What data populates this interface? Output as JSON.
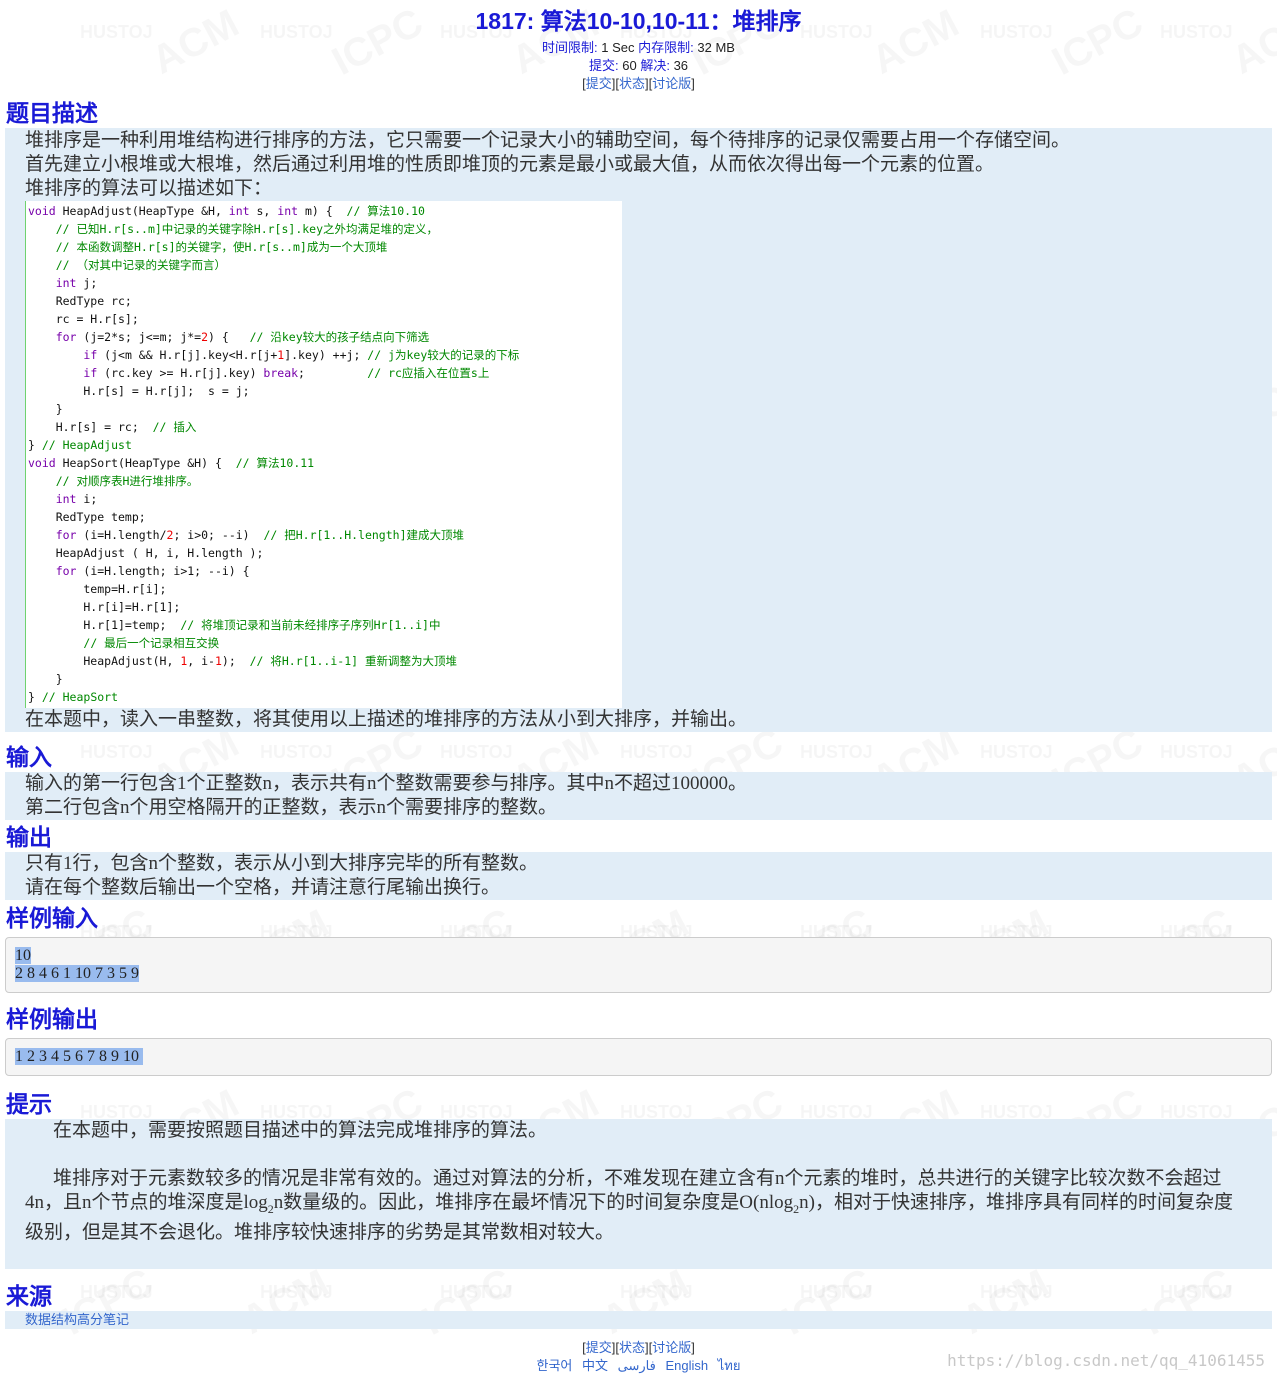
{
  "header": {
    "title": "1817: 算法10-10,10-11：堆排序",
    "time_label": "时间限制:",
    "time_value": "1 Sec",
    "mem_label": "内存限制:",
    "mem_value": "32 MB",
    "submit_label": "提交:",
    "submit_value": "60",
    "solved_label": "解决:",
    "solved_value": "36",
    "links": [
      "提交",
      "状态",
      "讨论版"
    ]
  },
  "description": {
    "heading": "题目描述",
    "intro": [
      "堆排序是一种利用堆结构进行排序的方法，它只需要一个记录大小的辅助空间，每个待排序的记录仅需要占用一个存储空间。",
      "首先建立小根堆或大根堆，然后通过利用堆的性质即堆顶的元素是最小或最大值，从而依次得出每一个元素的位置。",
      "堆排序的算法可以描述如下："
    ],
    "code": [
      "void HeapAdjust(HeapType &H, int s, int m) {  // 算法10.10",
      "    // 已知H.r[s..m]中记录的关键字除H.r[s].key之外均满足堆的定义，",
      "    // 本函数调整H.r[s]的关键字，使H.r[s..m]成为一个大顶堆",
      "    // （对其中记录的关键字而言）",
      "    int j;",
      "    RedType rc;",
      "    rc = H.r[s];",
      "    for (j=2*s; j<=m; j*=2) {   // 沿key较大的孩子结点向下筛选",
      "        if (j<m && H.r[j].key<H.r[j+1].key) ++j; // j为key较大的记录的下标",
      "        if (rc.key >= H.r[j].key) break;         // rc应插入在位置s上",
      "        H.r[s] = H.r[j];  s = j;",
      "    }",
      "    H.r[s] = rc;  // 插入",
      "} // HeapAdjust",
      "void HeapSort(HeapType &H) {  // 算法10.11",
      "    // 对顺序表H进行堆排序。",
      "    int i;",
      "    RedType temp;",
      "    for (i=H.length/2; i>0; --i)  // 把H.r[1..H.length]建成大顶堆",
      "    HeapAdjust ( H, i, H.length );",
      "    for (i=H.length; i>1; --i) {",
      "        temp=H.r[i];",
      "        H.r[i]=H.r[1];",
      "        H.r[1]=temp;  // 将堆顶记录和当前未经排序子序列Hr[1..i]中",
      "        // 最后一个记录相互交换",
      "        HeapAdjust(H, 1, i-1);  // 将H.r[1..i-1] 重新调整为大顶堆",
      "    }",
      "} // HeapSort"
    ],
    "outro": "在本题中，读入一串整数，将其使用以上描述的堆排序的方法从小到大排序，并输出。"
  },
  "input": {
    "heading": "输入",
    "lines": [
      "输入的第一行包含1个正整数n，表示共有n个整数需要参与排序。其中n不超过100000。",
      "第二行包含n个用空格隔开的正整数，表示n个需要排序的整数。"
    ]
  },
  "output": {
    "heading": "输出",
    "lines": [
      "只有1行，包含n个整数，表示从小到大排序完毕的所有整数。",
      "请在每个整数后输出一个空格，并请注意行尾输出换行。"
    ]
  },
  "sample_input": {
    "heading": "样例输入",
    "lines": [
      "10",
      "2 8 4 6 1 10 7 3 5 9"
    ]
  },
  "sample_output": {
    "heading": "样例输出",
    "lines": [
      "1 2 3 4 5 6 7 8 9 10 "
    ]
  },
  "hint": {
    "heading": "提示",
    "p1": "在本题中，需要按照题目描述中的算法完成堆排序的算法。",
    "p2_a": "堆排序对于元素数较多的情况是非常有效的。通过对算法的分析，不难发现在建立含有n个元素的堆时，总共进行的关键字比较次数不会超过4n，且n个节点的堆深度是log",
    "p2_sub1": "2",
    "p2_b": "n数量级的。因此，堆排序在最坏情况下的时间复杂度是O(nlog",
    "p2_sub2": "2",
    "p2_c": "n)，相对于快速排序，堆排序具有同样的时间复杂度级别，但是其不会退化。堆排序较快速排序的劣势是其常数相对较大。"
  },
  "source": {
    "heading": "来源",
    "text": "数据结构高分笔记"
  },
  "footer": {
    "links": [
      "提交",
      "状态",
      "讨论版"
    ],
    "languages": [
      "한국어",
      "中文",
      "فارسی",
      "English",
      "ไทย"
    ]
  },
  "watermark": {
    "url": "https://blog.csdn.net/qq_41061455",
    "marks": [
      "ACM",
      "ICPC",
      "HUSTOJ"
    ]
  }
}
